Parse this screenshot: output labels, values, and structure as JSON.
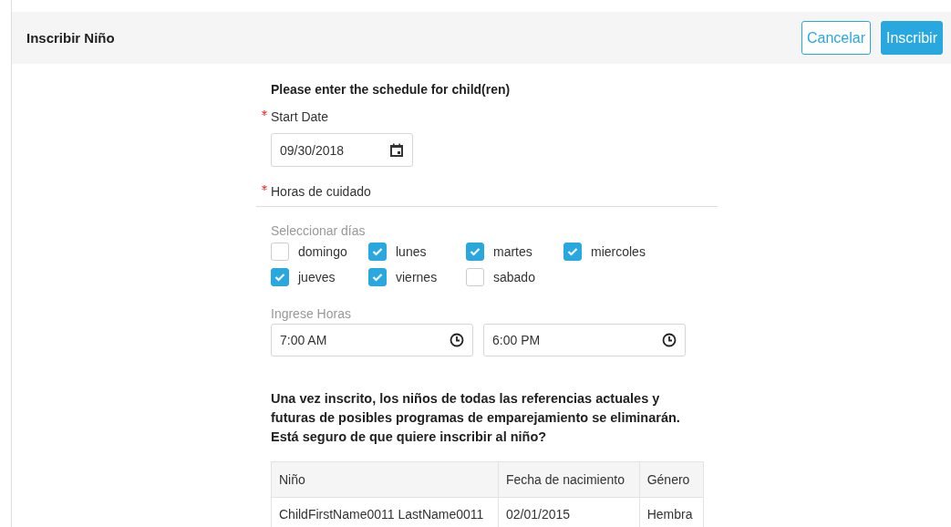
{
  "header": {
    "title": "Inscribir Niño",
    "buttons": [
      {
        "label": "Cancelar",
        "kind": "secondary"
      },
      {
        "label": "Inscribir",
        "kind": "primary"
      }
    ]
  },
  "form": {
    "heading": "Please enter the schedule for child(ren)",
    "start_date": {
      "label": "Start Date",
      "required": true,
      "value": "09/30/2018"
    },
    "care_hours": {
      "label": "Horas de cuidado",
      "required": true
    },
    "days_label": "Seleccionar días",
    "days": [
      {
        "label": "domingo",
        "checked": false
      },
      {
        "label": "lunes",
        "checked": true
      },
      {
        "label": "martes",
        "checked": true
      },
      {
        "label": "miercoles",
        "checked": true
      },
      {
        "label": "jueves",
        "checked": true
      },
      {
        "label": "viernes",
        "checked": true
      },
      {
        "label": "sabado",
        "checked": false
      }
    ],
    "hours_label": "Ingrese Horas",
    "hours": [
      {
        "value": "7:00 AM"
      },
      {
        "value": "6:00 PM"
      }
    ],
    "warning": "Una vez inscrito, los niños de todas las referencias actuales y futuras de posibles programas de emparejamiento se eliminarán. Está seguro de que quiere inscribir al niño?"
  },
  "table": {
    "columns": [
      "Niño",
      "Fecha de nacimiento",
      "Género"
    ],
    "rows": [
      [
        "ChildFirstName0011 LastName0011",
        "02/01/2015",
        "Hembra"
      ]
    ]
  }
}
